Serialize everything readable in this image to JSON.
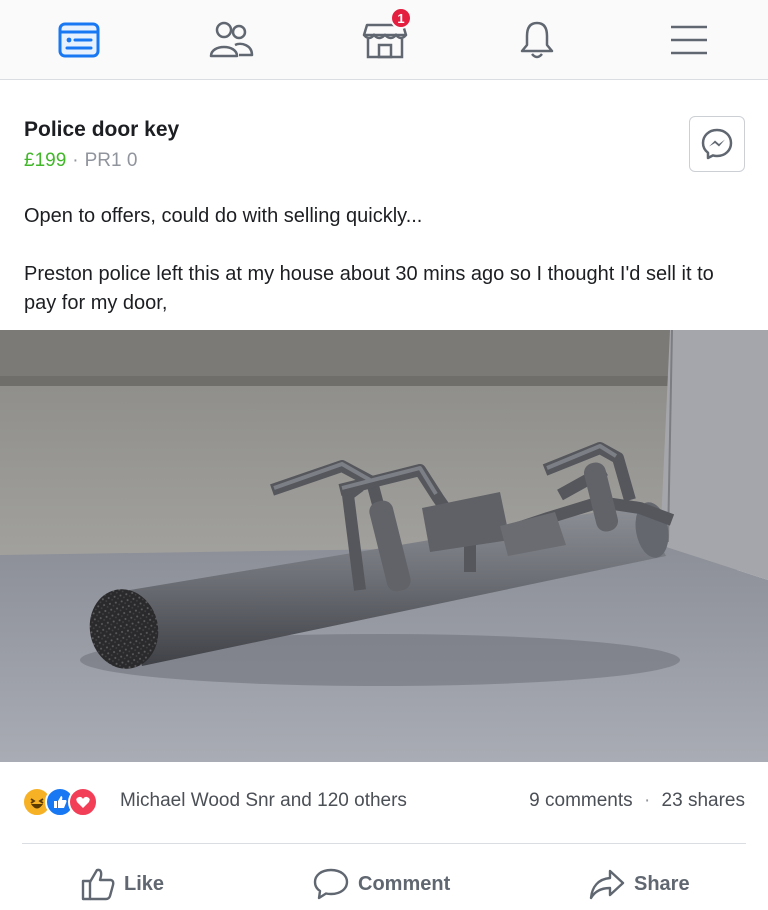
{
  "nav": {
    "items": [
      {
        "name": "news-feed-icon",
        "active": true
      },
      {
        "name": "friends-icon",
        "active": false
      },
      {
        "name": "marketplace-icon",
        "active": false
      },
      {
        "name": "notifications-bell-icon",
        "active": false
      },
      {
        "name": "menu-icon",
        "active": false
      }
    ],
    "marketplace_badge": "1",
    "accent_color": "#1877f2",
    "badge_color": "#e41e3f"
  },
  "listing": {
    "title": "Police door key",
    "price": "£199",
    "separator": "·",
    "location": "PR1 0",
    "message_icon": "messenger-icon",
    "description_line1": "Open to offers, could do with selling quickly...",
    "description_line2": "Preston police left this at my house about 30 mins ago so I thought I'd sell it to pay for my door,",
    "price_color": "#42b72a"
  },
  "photo": {
    "icon": "photo-battering-ram"
  },
  "engagement": {
    "reaction_icons": [
      "haha-reaction-icon",
      "like-reaction-icon",
      "love-reaction-icon"
    ],
    "reactors": "Michael Wood Snr and 120 others",
    "comments": "9 comments",
    "counts_separator": "·",
    "shares": "23 shares"
  },
  "actions": {
    "like": "Like",
    "comment": "Comment",
    "share": "Share"
  }
}
